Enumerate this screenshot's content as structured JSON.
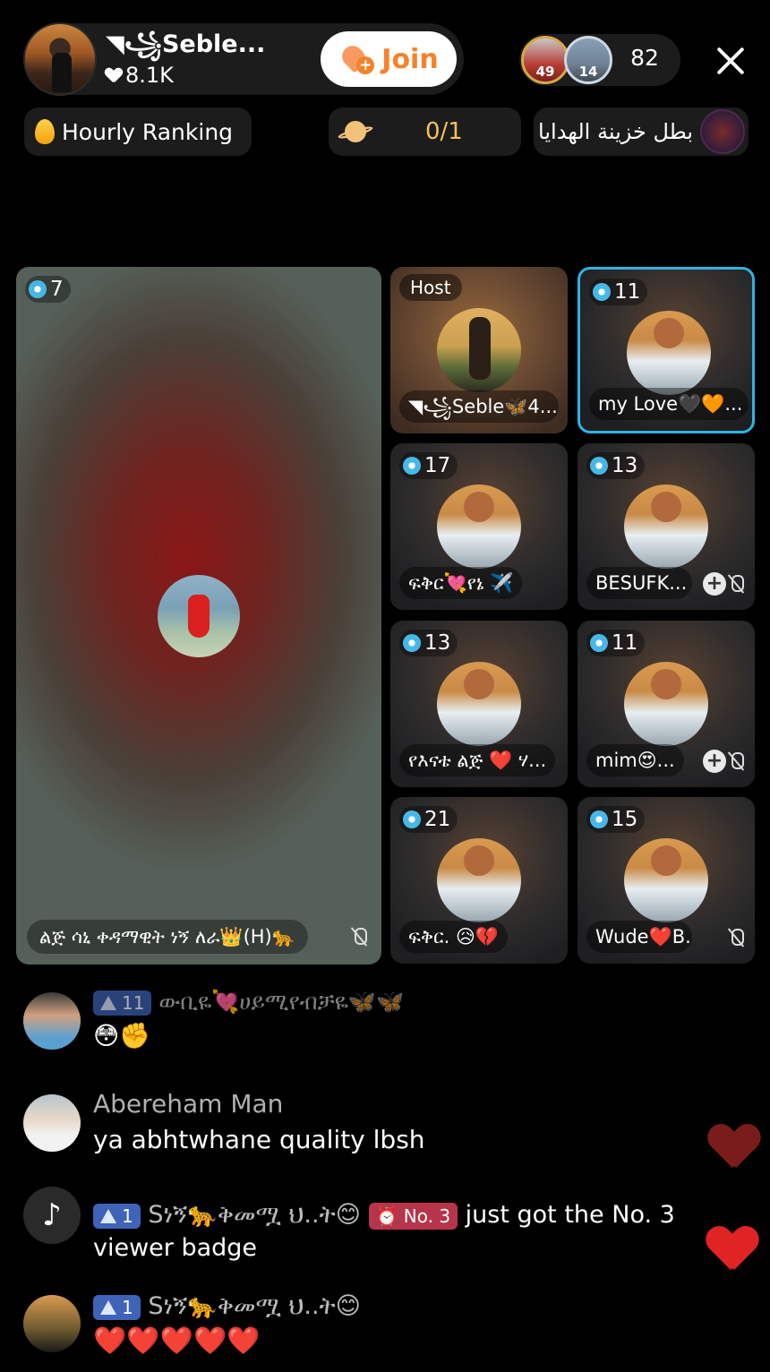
{
  "header": {
    "host_name": "◥꧁Seble...",
    "host_likes": "8.1K",
    "join_label": "Join",
    "viewer_badge_1": "49",
    "viewer_badge_2": "14",
    "viewer_count": "82"
  },
  "subbar": {
    "ranking_label": "Hourly Ranking",
    "gift_goal": "0/1",
    "gift_hero": "بطل خزينة الهدايا"
  },
  "main_tile": {
    "gem_count": "7",
    "label": "ልጅ ሳኒ ቀዳማዊት ነኝ ለራ👑(H)🐆"
  },
  "tiles": [
    {
      "badge": "Host",
      "label": "◥꧁Seble🦋4..."
    },
    {
      "gem": "11",
      "label": "my Love🖤🧡..."
    },
    {
      "gem": "17",
      "label": "ፍቅር💘የኔ ✈️"
    },
    {
      "gem": "13",
      "label": "BESUFK..."
    },
    {
      "gem": "13",
      "label": "የእናቴ ልጅ ❤️ ሃ..."
    },
    {
      "gem": "11",
      "label": "mim😍..."
    },
    {
      "gem": "21",
      "label": "ፍቅር. 😥💔"
    },
    {
      "gem": "15",
      "label": "Wude❤️B..."
    }
  ],
  "chat": [
    {
      "level": "11",
      "name": "ውቢዬ💘ሀይሚየብቻዬ🦋🦋",
      "message": "😳✊"
    },
    {
      "name": "Abereham Man",
      "message": "ya abhtwhane quality lbsh"
    },
    {
      "level": "1",
      "name": "Sነኝ🐆ቅመሟ ህ..ት😊",
      "badge": "⏰ No. 3",
      "message": "just got the No. 3",
      "message2": "viewer badge"
    },
    {
      "level": "1",
      "name": "Sነኝ🐆ቅመሟ ህ..ት😊",
      "message": "❤️❤️❤️❤️❤️"
    }
  ],
  "colors": {
    "accent_join": "#f5822a",
    "active_tile": "#2fb3e0",
    "gift_goal": "#f4c25a",
    "level_badge": "#3e63b8"
  }
}
